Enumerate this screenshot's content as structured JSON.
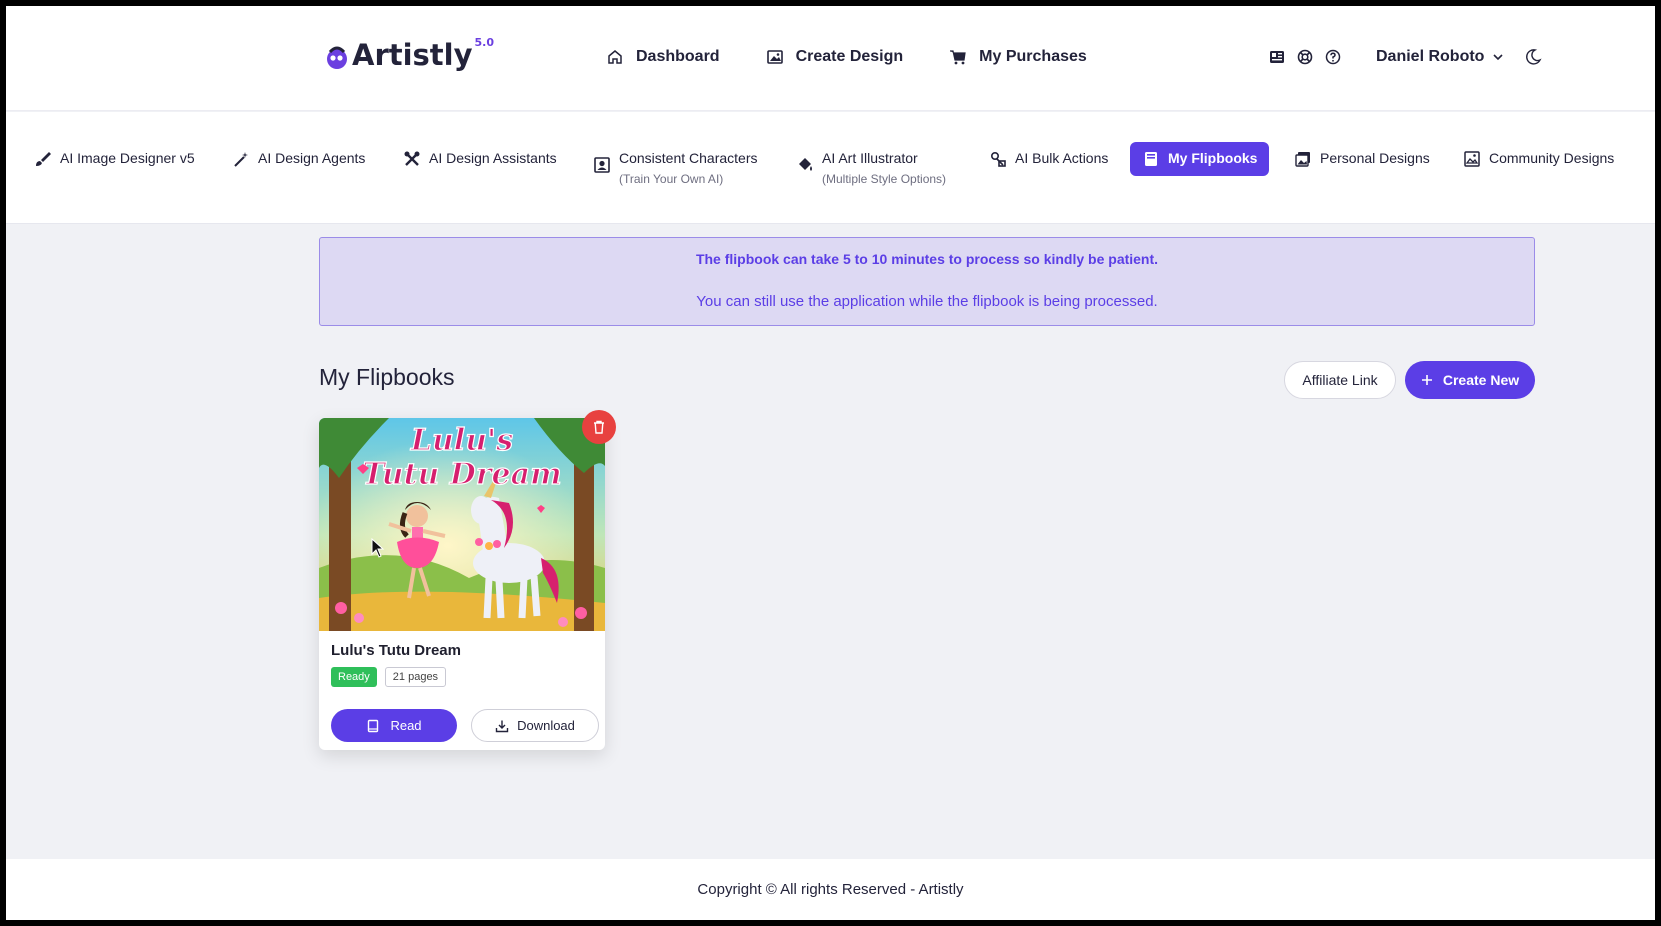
{
  "brand": {
    "name": "Artistly",
    "version": "5.0",
    "accent": "#5b3ee6"
  },
  "topnav": [
    {
      "label": "Dashboard",
      "icon": "home-icon"
    },
    {
      "label": "Create Design",
      "icon": "image-icon"
    },
    {
      "label": "My Purchases",
      "icon": "cart-icon"
    }
  ],
  "user": {
    "name": "Daniel Roboto"
  },
  "toolnav": [
    {
      "label": "AI Image Designer v5",
      "sub": "",
      "icon": "brush-icon"
    },
    {
      "label": "AI Design Agents",
      "sub": "",
      "icon": "magic-wand-icon"
    },
    {
      "label": "AI Design Assistants",
      "sub": "",
      "icon": "tools-icon"
    },
    {
      "label": "Consistent Characters",
      "sub": "(Train Your Own AI)",
      "icon": "portrait-icon"
    },
    {
      "label": "AI Art Illustrator",
      "sub": "(Multiple Style Options)",
      "icon": "paint-bucket-icon"
    },
    {
      "label": "AI Bulk Actions",
      "sub": "",
      "icon": "bulk-shapes-icon"
    },
    {
      "label": "My Flipbooks",
      "sub": "",
      "icon": "book-icon",
      "active": true
    },
    {
      "label": "Personal Designs",
      "sub": "",
      "icon": "gallery-icon"
    },
    {
      "label": "Community Designs",
      "sub": "",
      "icon": "community-gallery-icon"
    }
  ],
  "notice": {
    "line1": "The flipbook can take 5 to 10 minutes to process so kindly be patient.",
    "line2": "You can still use the application while the flipbook is being processed."
  },
  "section": {
    "title": "My Flipbooks",
    "affiliate_label": "Affiliate Link",
    "create_label": "Create New"
  },
  "flipbooks": [
    {
      "title": "Lulu's Tutu Dream",
      "cover_title_line1": "Lulu's",
      "cover_title_line2": "Tutu Dream",
      "status": "Ready",
      "pages": "21 pages",
      "read_label": "Read",
      "download_label": "Download"
    }
  ],
  "footer": {
    "text": "Copyright © All rights Reserved - Artistly"
  }
}
